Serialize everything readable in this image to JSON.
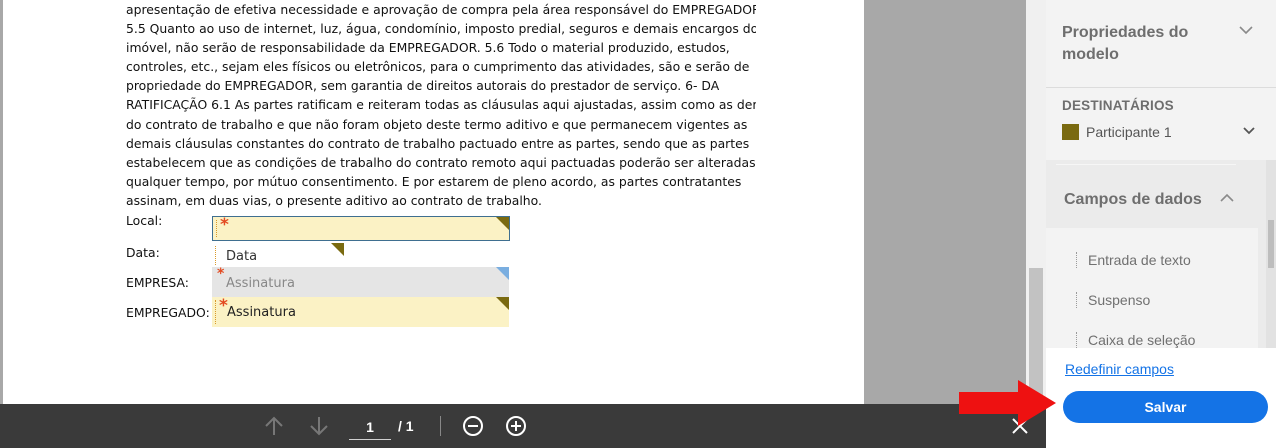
{
  "document": {
    "lines": [
      "apresentação de efetiva necessidade e aprovação de compra pela área responsável do EMPREGADOR.",
      "5.5 Quanto ao uso de internet, luz, água, condomínio, imposto predial, seguros e demais encargos do",
      "imóvel, não serão de responsabilidade da EMPREGADOR. 5.6 Todo o material produzido, estudos,",
      "controles, etc., sejam eles físicos ou eletrônicos, para o cumprimento das atividades, são e serão de",
      "propriedade do EMPREGADOR, sem garantia de direitos autorais do prestador de serviço. 6- DA",
      "RATIFICAÇÃO 6.1 As partes ratificam e reiteram todas as cláusulas aqui ajustadas, assim como as demais",
      "do contrato de trabalho e que não foram objeto deste termo aditivo e que permanecem vigentes as",
      "demais cláusulas constantes do contrato de trabalho pactuado entre as partes, sendo que as partes",
      "estabelecem que as condições de trabalho do contrato remoto aqui pactuadas poderão ser alteradas a",
      "qualquer tempo, por mútuo consentimento. E por estarem de pleno acordo, as partes contratantes",
      "assinam, em duas vias, o presente aditivo ao contrato de trabalho."
    ],
    "labels": {
      "local": "Local:",
      "data": "Data:",
      "empresa": "EMPRESA:",
      "empregado": "EMPREGADO:"
    },
    "fields": {
      "local_required": "*",
      "data_text": "Data",
      "empresa_required": "*",
      "empresa_text": "Assinatura",
      "empregado_required": "*",
      "empregado_text": "Assinatura"
    }
  },
  "toolbar": {
    "page_current": "1",
    "page_total": "/ 1",
    "icons": [
      "arrow-up-icon",
      "arrow-down-icon",
      "zoom-out-icon",
      "zoom-in-icon",
      "close-icon"
    ]
  },
  "panel": {
    "properties_title": "Propriedades do modelo",
    "recipients_label": "DESTINATÁRIOS",
    "participant_name": "Participante 1",
    "participant_color": "#7a6a10",
    "data_fields_title": "Campos de dados",
    "data_field_items": [
      "Entrada de texto",
      "Suspenso",
      "Caixa de seleção"
    ],
    "reset_link": "Redefinir campos",
    "save_label": "Salvar"
  },
  "colors": {
    "accent": "#1473e6",
    "field_yellow": "#fbf2c5",
    "annotation_arrow": "#ee1111"
  }
}
